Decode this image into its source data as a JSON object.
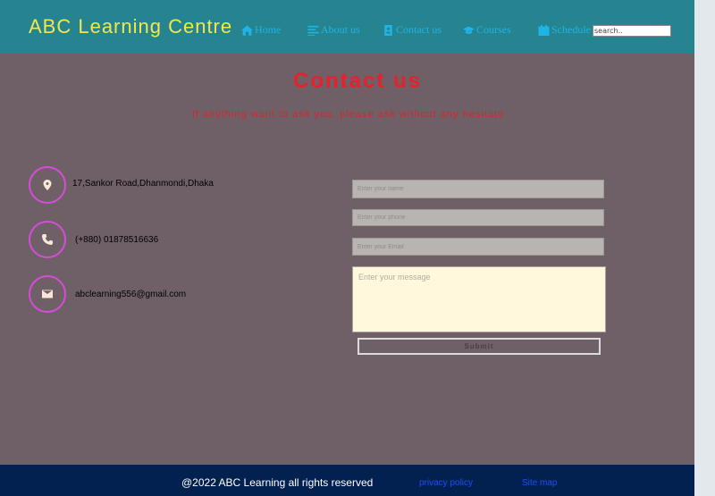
{
  "header": {
    "brand": "ABC Learning Centre",
    "nav": [
      {
        "label": "Home",
        "icon": "home-icon"
      },
      {
        "label": "About us",
        "icon": "list-icon"
      },
      {
        "label": "Contact us",
        "icon": "contact-card-icon"
      },
      {
        "label": "Courses",
        "icon": "graduation-cap-icon"
      },
      {
        "label": "Schedule",
        "icon": "calendar-icon"
      }
    ],
    "search_placeholder": "search.."
  },
  "main": {
    "title": "Contact us",
    "subtitle": "If anything want to ask you, please ask without any hesitate",
    "contacts": [
      {
        "icon": "location-pin-icon",
        "text": "17,Sankor Road,Dhanmondi,Dhaka"
      },
      {
        "icon": "phone-icon",
        "text": "(+880) 01878516636"
      },
      {
        "icon": "envelope-icon",
        "text": "abclearning556@gmail.com"
      }
    ],
    "form": {
      "name_placeholder": "Enter your name",
      "phone_placeholder": "Enter your phone",
      "email_placeholder": "Enter your Email",
      "message_placeholder": "Enter your message",
      "submit_label": "Submit"
    }
  },
  "footer": {
    "copyright": "@2022 ABC Learning all rights reserved",
    "links": [
      "privacy policy",
      "Site map"
    ]
  },
  "colors": {
    "navbar": "#25848f",
    "brand": "#f2e84a",
    "nav_link": "#1fb4e8",
    "background": "#6f6068",
    "title": "#e8202a",
    "footer": "#032150",
    "footer_link": "#1a4ff5"
  }
}
